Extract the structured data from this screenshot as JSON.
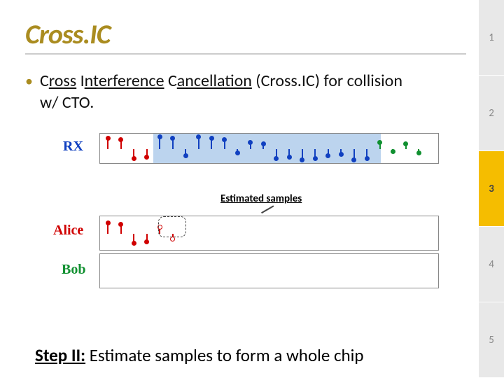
{
  "title": "Cross.IC",
  "bullet": {
    "pre1": "C",
    "u1": "ross",
    "mid1": " ",
    "pre2": "I",
    "u2": "nterference",
    "mid2": " ",
    "pre3": "C",
    "u3": "ancellation",
    "rest": " (Cross.IC) for collision w/ CTO."
  },
  "labels": {
    "rx": "RX",
    "alice": "Alice",
    "bob": "Bob",
    "estimated": "Estimated samples"
  },
  "nav": [
    "1",
    "2",
    "3",
    "4",
    "5"
  ],
  "nav_active_index": 2,
  "step": {
    "prefix": "Step II:",
    "rest": " Estimate samples to form a whole chip"
  },
  "chart_data": {
    "type": "table",
    "title": "RX samples with Alice/Bob decomposition",
    "rx_samples": [
      {
        "i": 0,
        "color": "red",
        "dir": "up",
        "h": 16
      },
      {
        "i": 1,
        "color": "red",
        "dir": "up",
        "h": 14
      },
      {
        "i": 2,
        "color": "red",
        "dir": "down",
        "h": 14
      },
      {
        "i": 3,
        "color": "red",
        "dir": "down",
        "h": 12
      },
      {
        "i": 4,
        "color": "blue",
        "dir": "up",
        "h": 18
      },
      {
        "i": 5,
        "color": "blue",
        "dir": "up",
        "h": 16
      },
      {
        "i": 6,
        "color": "blue",
        "dir": "down",
        "h": 10
      },
      {
        "i": 7,
        "color": "blue",
        "dir": "up",
        "h": 18
      },
      {
        "i": 8,
        "color": "blue",
        "dir": "up",
        "h": 16
      },
      {
        "i": 9,
        "color": "blue",
        "dir": "up",
        "h": 14
      },
      {
        "i": 10,
        "color": "blue",
        "dir": "down",
        "h": 6
      },
      {
        "i": 11,
        "color": "blue",
        "dir": "up",
        "h": 10
      },
      {
        "i": 12,
        "color": "blue",
        "dir": "up",
        "h": 8
      },
      {
        "i": 13,
        "color": "blue",
        "dir": "down",
        "h": 14
      },
      {
        "i": 14,
        "color": "blue",
        "dir": "down",
        "h": 12
      },
      {
        "i": 15,
        "color": "blue",
        "dir": "down",
        "h": 16
      },
      {
        "i": 16,
        "color": "blue",
        "dir": "down",
        "h": 14
      },
      {
        "i": 17,
        "color": "blue",
        "dir": "down",
        "h": 10
      },
      {
        "i": 18,
        "color": "blue",
        "dir": "down",
        "h": 8
      },
      {
        "i": 19,
        "color": "blue",
        "dir": "down",
        "h": 16
      },
      {
        "i": 20,
        "color": "blue",
        "dir": "down",
        "h": 14
      },
      {
        "i": 21,
        "color": "green",
        "dir": "up",
        "h": 10
      },
      {
        "i": 22,
        "color": "green",
        "dir": "down",
        "h": 4
      },
      {
        "i": 23,
        "color": "green",
        "dir": "up",
        "h": 8
      },
      {
        "i": 24,
        "color": "green",
        "dir": "down",
        "h": 6
      }
    ],
    "alice_samples": [
      {
        "i": 0,
        "dir": "up",
        "h": 16
      },
      {
        "i": 1,
        "dir": "up",
        "h": 14
      },
      {
        "i": 2,
        "dir": "down",
        "h": 14
      },
      {
        "i": 3,
        "dir": "down",
        "h": 12
      },
      {
        "i": 4,
        "dir": "up",
        "h": 10,
        "est": true
      },
      {
        "i": 5,
        "dir": "down",
        "h": 8,
        "est": true
      }
    ],
    "colors": {
      "red": "#d00000",
      "blue": "#1040c0",
      "green": "#109030"
    }
  }
}
